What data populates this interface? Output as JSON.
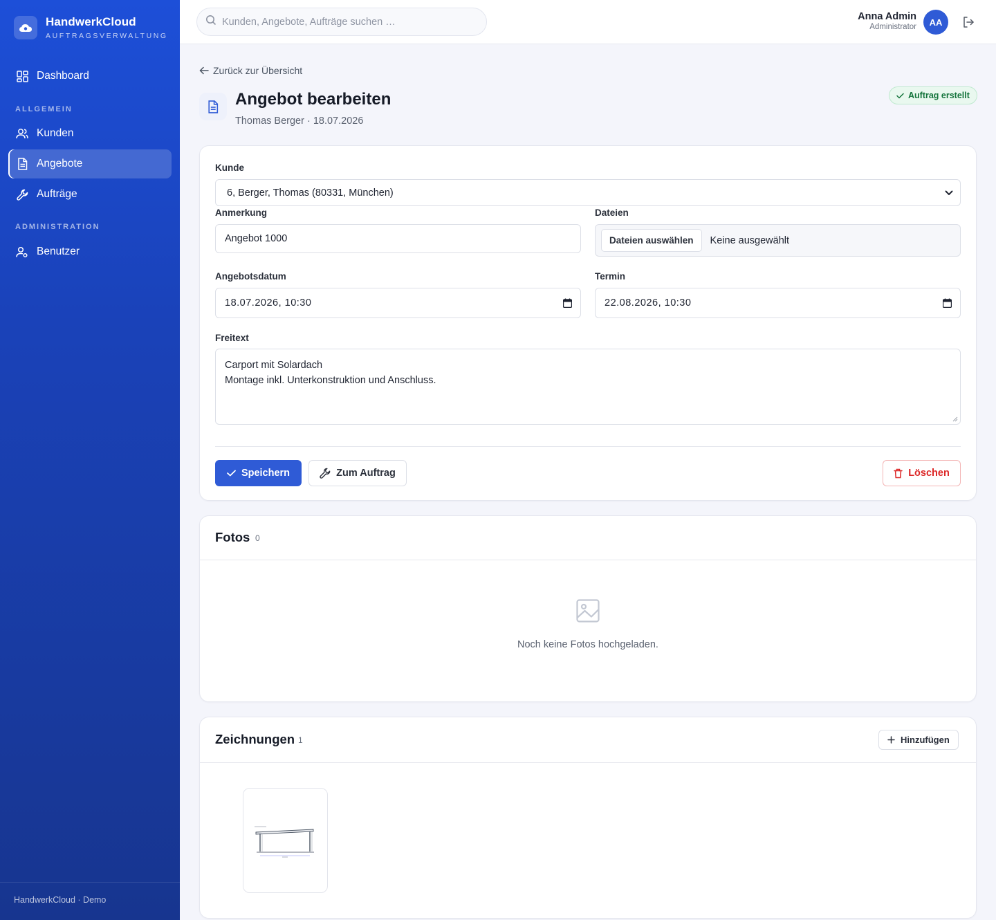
{
  "app": {
    "name": "HandwerkCloud",
    "subtitle": "AUFTRAGSVERWALTUNG",
    "footer": "HandwerkCloud · Demo"
  },
  "sidebar": {
    "dashboard": "Dashboard",
    "section_general": "ALLGEMEIN",
    "customers": "Kunden",
    "offers": "Angebote",
    "orders": "Aufträge",
    "section_admin": "ADMINISTRATION",
    "users": "Benutzer"
  },
  "topbar": {
    "search_placeholder": "Kunden, Angebote, Aufträge suchen …",
    "user_name": "Anna Admin",
    "user_role": "Administrator",
    "avatar_initials": "AA"
  },
  "page": {
    "back_link": "Zurück zur Übersicht",
    "title": "Angebot bearbeiten",
    "subtitle": "Thomas Berger · 18.07.2026",
    "status": "Auftrag erstellt"
  },
  "form": {
    "customer_label": "Kunde",
    "customer_value": "6, Berger, Thomas (80331, München)",
    "note_label": "Anmerkung",
    "note_value": "Angebot 1000",
    "files_label": "Dateien",
    "files_button": "Dateien auswählen",
    "files_none": "Keine ausgewählt",
    "offer_date_label": "Angebotsdatum",
    "offer_date_value": "18.07.2026, 10:30",
    "appointment_label": "Termin",
    "appointment_value": "22.08.2026, 10:30",
    "freetext_label": "Freitext",
    "freetext_line1": "Carport mit Solardach",
    "freetext_line2": "Montage inkl. Unterkonstruktion und Anschluss.",
    "save_button": "Speichern",
    "to_order_button": "Zum Auftrag",
    "delete_button": "Löschen"
  },
  "photos": {
    "title": "Fotos",
    "count": "0",
    "empty_text": "Noch keine Fotos hochgeladen."
  },
  "drawings": {
    "title": "Zeichnungen",
    "count": "1",
    "add_button": "Hinzufügen"
  },
  "colors": {
    "primary": "#2f5bd6",
    "danger": "#dc2626",
    "success": "#14743c"
  }
}
